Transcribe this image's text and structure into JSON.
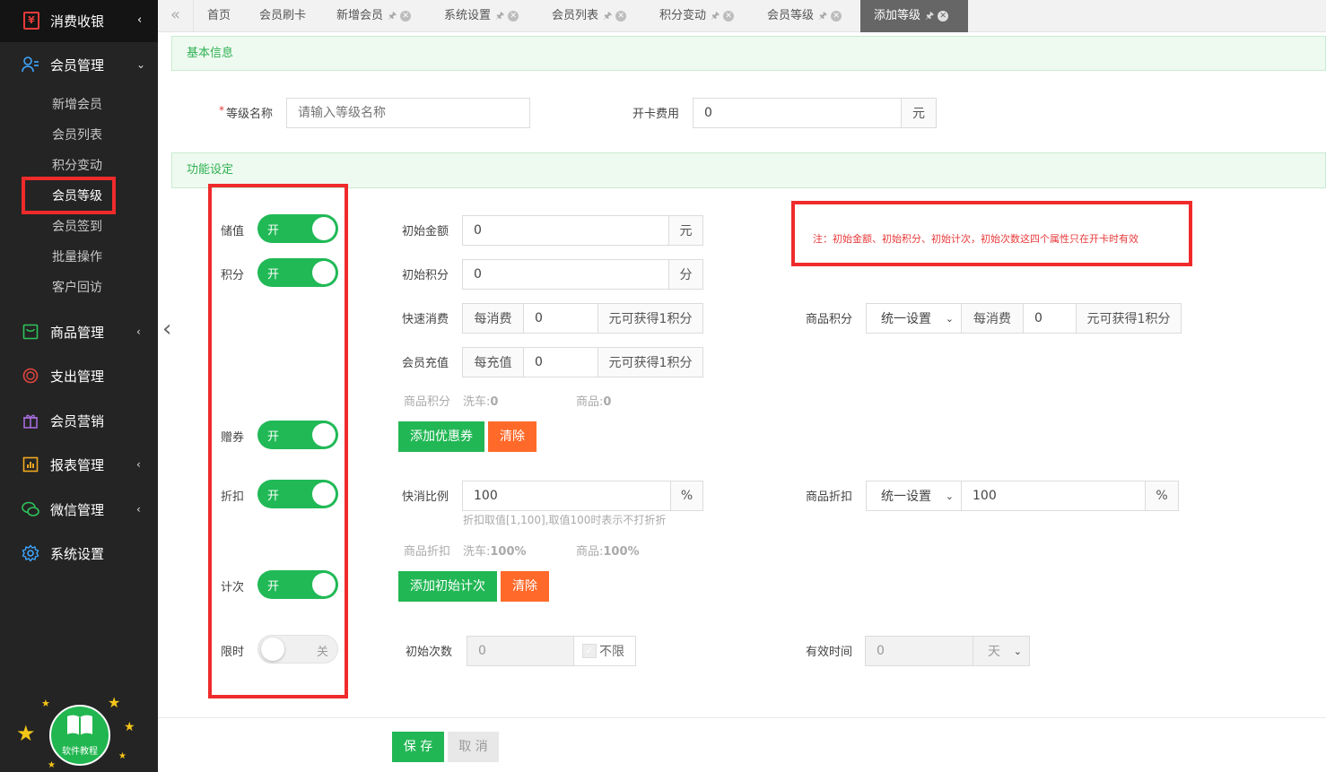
{
  "sidebar": {
    "top_label": "消费收银",
    "member_mgmt": "会员管理",
    "sub_items": [
      "新增会员",
      "会员列表",
      "积分变动",
      "会员等级",
      "会员签到",
      "批量操作",
      "客户回访"
    ],
    "menus": [
      "商品管理",
      "支出管理",
      "会员营销",
      "报表管理",
      "微信管理",
      "系统设置"
    ],
    "tutorial": "软件教程"
  },
  "tabs": [
    {
      "label": "首页"
    },
    {
      "label": "会员刷卡"
    },
    {
      "label": "新增会员"
    },
    {
      "label": "系统设置"
    },
    {
      "label": "会员列表"
    },
    {
      "label": "积分变动"
    },
    {
      "label": "会员等级"
    },
    {
      "label": "添加等级",
      "active": true
    }
  ],
  "basic": {
    "section_title": "基本信息",
    "required_mark": "*",
    "level_name_label": "等级名称",
    "level_name_placeholder": "请输入等级名称",
    "card_fee_label": "开卡费用",
    "card_fee_value": "0",
    "card_fee_unit": "元"
  },
  "func": {
    "section_title": "功能设定",
    "toggles": {
      "stored": {
        "label": "储值",
        "state": "开"
      },
      "points": {
        "label": "积分",
        "state": "开"
      },
      "coupon": {
        "label": "赠券",
        "state": "开"
      },
      "discount": {
        "label": "折扣",
        "state": "开"
      },
      "count": {
        "label": "计次",
        "state": "开"
      },
      "timelimit": {
        "label": "限时",
        "state": "关"
      }
    },
    "note": "注：初始金额、初始积分、初始计次，初始次数这四个属性只在开卡时有效",
    "init_amount": {
      "label": "初始金额",
      "value": "0",
      "unit": "元"
    },
    "init_points": {
      "label": "初始积分",
      "value": "0",
      "unit": "分"
    },
    "quick_consume": {
      "label": "快速消费",
      "prefix": "每消费",
      "value": "0",
      "suffix": "元可获得1积分"
    },
    "member_recharge": {
      "label": "会员充值",
      "prefix": "每充值",
      "value": "0",
      "suffix": "元可获得1积分"
    },
    "goods_points": {
      "label": "商品积分",
      "select": "统一设置",
      "prefix": "每消费",
      "value": "0",
      "suffix": "元可获得1积分"
    },
    "goods_points_summary": {
      "label": "商品积分",
      "car_wash": "洗车:",
      "car_wash_val": "0",
      "goods": "商品:",
      "goods_val": "0"
    },
    "add_coupon_btn": "添加优惠券",
    "clear_btn": "清除",
    "quick_ratio": {
      "label": "快消比例",
      "value": "100",
      "unit": "%",
      "hint": "折扣取值[1,100],取值100时表示不打折折"
    },
    "goods_discount": {
      "label": "商品折扣",
      "select": "统一设置",
      "value": "100",
      "unit": "%"
    },
    "goods_discount_summary": {
      "label": "商品折扣",
      "car_wash": "洗车:",
      "car_wash_val": "100%",
      "goods": "商品:",
      "goods_val": "100%"
    },
    "add_count_btn": "添加初始计次",
    "init_times": {
      "label": "初始次数",
      "value": "0",
      "unlimited": "不限"
    },
    "valid_time": {
      "label": "有效时间",
      "value": "0",
      "unit": "天"
    }
  },
  "footer": {
    "save": "保 存",
    "cancel": "取 消"
  }
}
